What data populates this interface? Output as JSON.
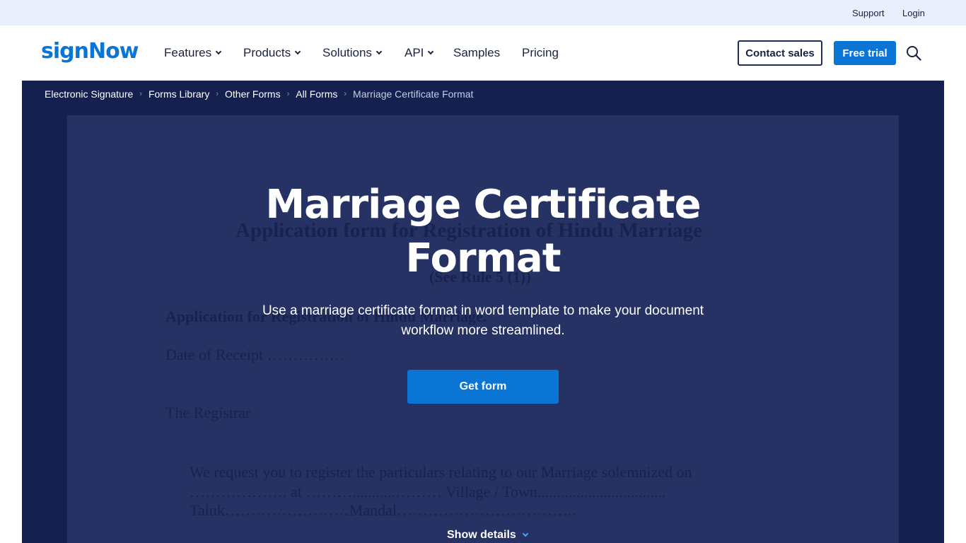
{
  "topbar": {
    "support": "Support",
    "login": "Login"
  },
  "nav": {
    "logo": "signNow",
    "items": [
      {
        "label": "Features",
        "dropdown": true
      },
      {
        "label": "Products",
        "dropdown": true
      },
      {
        "label": "Solutions",
        "dropdown": true
      },
      {
        "label": "API",
        "dropdown": true
      },
      {
        "label": "Samples",
        "dropdown": false
      },
      {
        "label": "Pricing",
        "dropdown": false
      }
    ],
    "contact_sales": "Contact sales",
    "free_trial": "Free trial"
  },
  "breadcrumb": [
    "Electronic Signature",
    "Forms Library",
    "Other Forms",
    "All Forms",
    "Marriage Certificate Format"
  ],
  "hero": {
    "title": "Marriage Certificate Format",
    "subtitle": "Use a marriage certificate format in word template to make your document workflow more streamlined.",
    "cta": "Get form",
    "show_details": "Show details"
  },
  "document_preview": [
    "Application form for Registration of Hindu Marriage",
    "(See Rule 5 (1))",
    "Application for Registration of Hindu Marriage.",
    "Date of Receipt ……………",
    "The Registrar",
    "We request you to register the particulars relating to our Marriage solemnized on",
    "………………. at ………...........……… Village / Town.................................",
    "Taluk……………………Mandal…………………………….."
  ],
  "colors": {
    "brand": "#0b75d6",
    "hero_bg": "#14214f",
    "topbar_bg": "#e9effc"
  }
}
